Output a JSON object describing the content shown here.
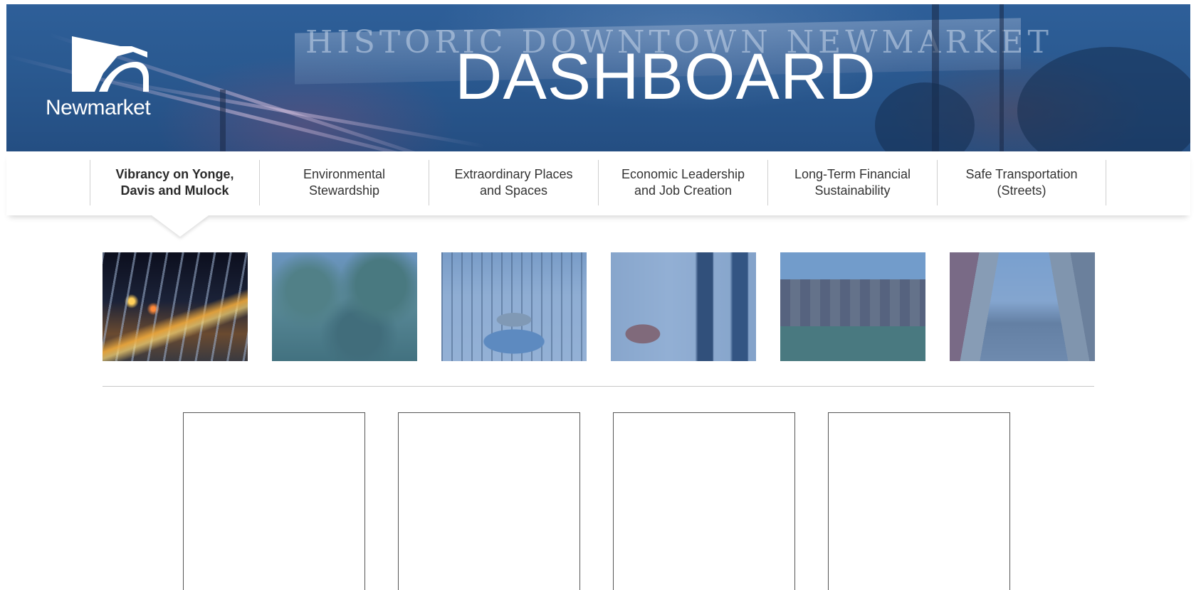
{
  "header": {
    "logo_text": "Newmarket",
    "title": "DASHBOARD",
    "background_sign_text": "HISTORIC DOWNTOWN NEWMARKET"
  },
  "tabs": [
    {
      "label": "Vibrancy on Yonge,\nDavis and Mulock",
      "active": true
    },
    {
      "label": "Environmental\nStewardship",
      "active": false
    },
    {
      "label": "Extraordinary Places\nand Spaces",
      "active": false
    },
    {
      "label": "Economic Leadership\nand Job Creation",
      "active": false
    },
    {
      "label": "Long-Term Financial\nSustainability",
      "active": false
    },
    {
      "label": "Safe Transportation\n(Streets)",
      "active": false
    }
  ],
  "thumbnails": [
    {
      "subject": "night-street-transit-station",
      "active": true
    },
    {
      "subject": "trees-and-river",
      "active": false
    },
    {
      "subject": "snowy-park-aerial",
      "active": false
    },
    {
      "subject": "business-meeting-office",
      "active": false
    },
    {
      "subject": "building-with-trees",
      "active": false
    },
    {
      "subject": "main-street-downtown",
      "active": false
    }
  ],
  "panels_count": 4,
  "colors": {
    "banner_blue": "#2a5990",
    "overlay_blue": "#4678b9",
    "tab_text": "#333333",
    "divider": "#c8c8c8"
  }
}
